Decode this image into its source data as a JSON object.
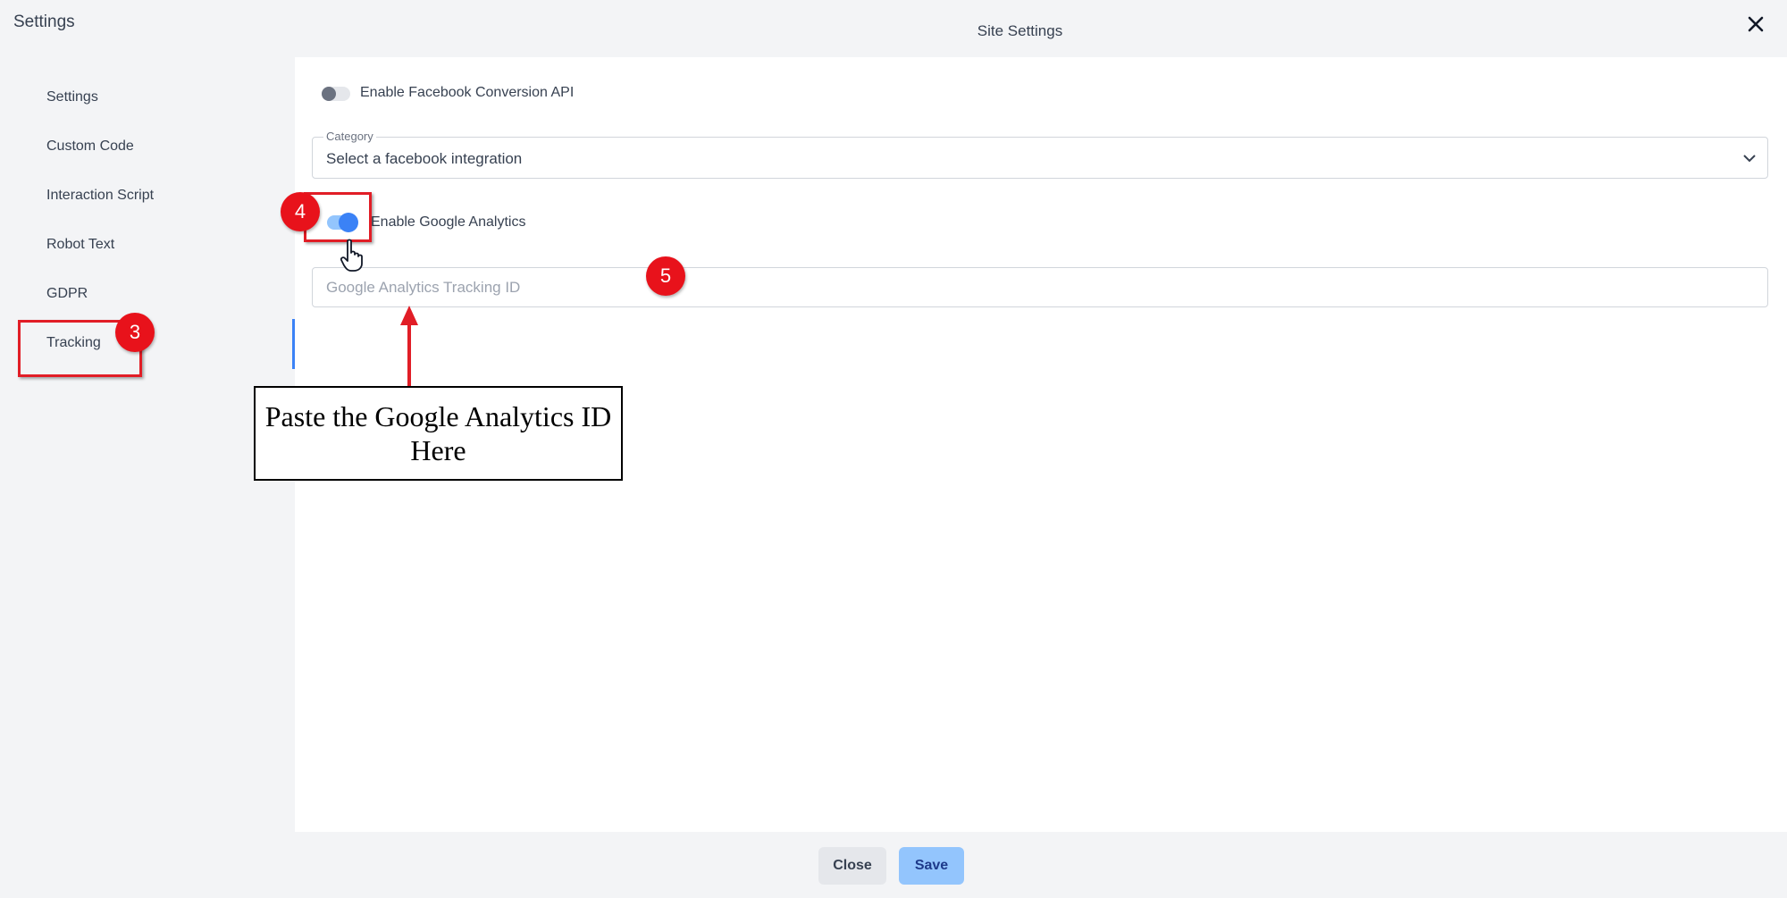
{
  "header": {
    "app_title": "Settings",
    "dialog_title": "Site Settings",
    "close_icon": "close-icon"
  },
  "sidebar": {
    "items": [
      {
        "label": "Settings"
      },
      {
        "label": "Custom Code"
      },
      {
        "label": "Interaction Script"
      },
      {
        "label": "Robot Text"
      },
      {
        "label": "GDPR"
      },
      {
        "label": "Tracking",
        "active": true
      }
    ]
  },
  "main": {
    "facebook_toggle": {
      "label": "Enable Facebook Conversion API",
      "on": false
    },
    "category": {
      "legend": "Category",
      "value": "Select a facebook integration"
    },
    "google_toggle": {
      "label": "Enable Google Analytics",
      "on": true
    },
    "tracking_input": {
      "placeholder": "Google Analytics Tracking ID",
      "value": ""
    }
  },
  "footer": {
    "close_label": "Close",
    "save_label": "Save"
  },
  "annotations": {
    "badge_3": "3",
    "badge_4": "4",
    "badge_5": "5",
    "callout": "Paste the  Google Analytics ID Here"
  },
  "colors": {
    "accent": "#3b82f6",
    "annotation_red": "#e8121b",
    "save_button": "#93c5fd"
  }
}
